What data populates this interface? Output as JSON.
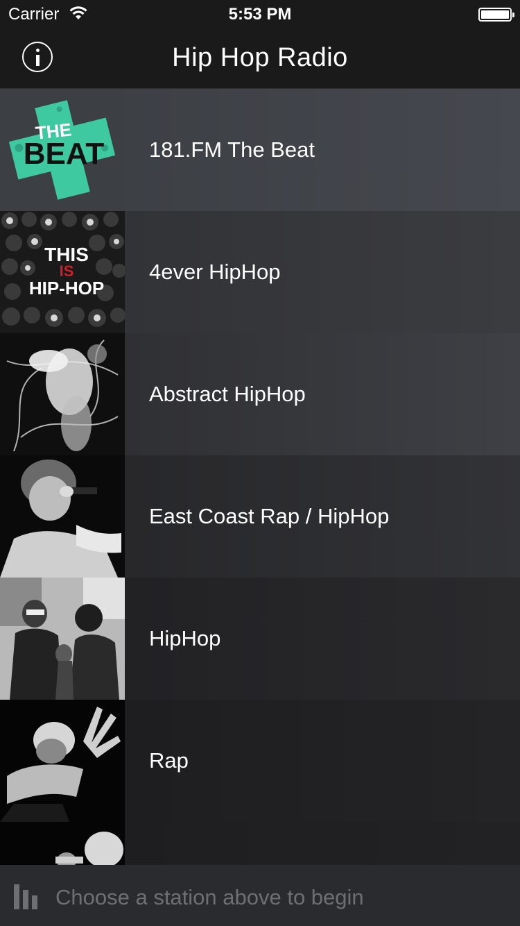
{
  "status_bar": {
    "carrier": "Carrier",
    "time": "5:53 PM"
  },
  "navbar": {
    "title": "Hip Hop Radio",
    "info_icon": "info-icon"
  },
  "stations": [
    {
      "name": "181.FM The Beat",
      "logo_text_1": "THE",
      "logo_text_2": "BEAT"
    },
    {
      "name": "4ever HipHop",
      "logo_text_1": "THIS",
      "logo_text_2": "IS",
      "logo_text_3": "HIP-HOP"
    },
    {
      "name": "Abstract HipHop"
    },
    {
      "name": "East Coast Rap / HipHop"
    },
    {
      "name": "HipHop"
    },
    {
      "name": "Rap"
    },
    {
      "name": ""
    }
  ],
  "player": {
    "prompt": "Choose a station above to begin",
    "icon": "equalizer-icon"
  },
  "colors": {
    "accent_green": "#3fc9a0",
    "dim_text": "#6e6f73"
  }
}
